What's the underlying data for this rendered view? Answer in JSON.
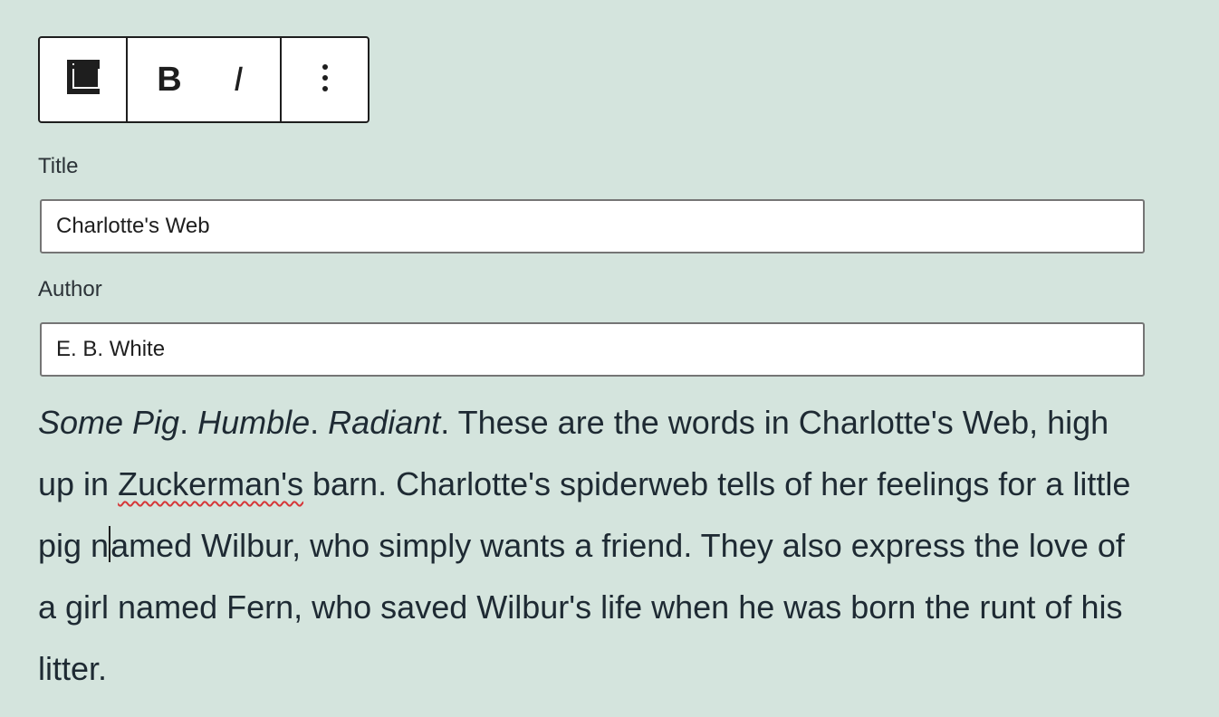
{
  "toolbar": {
    "block_icon": "book-icon",
    "bold_icon": "bold-icon",
    "bold_glyph": "B",
    "italic_icon": "italic-icon",
    "italic_glyph": "I",
    "more_icon": "more-vertical-icon"
  },
  "fields": {
    "title": {
      "label": "Title",
      "value": "Charlotte's Web"
    },
    "author": {
      "label": "Author",
      "value": "E. B. White"
    }
  },
  "description": {
    "italic_1": "Some Pig",
    "sep_1": ". ",
    "italic_2": "Humble",
    "sep_2": ". ",
    "italic_3": "Radiant",
    "text_1": ". These are the words in Charlotte's Web, high up in ",
    "misspelled": "Zuckerman's",
    "text_2": " barn. Charlotte's spiderweb tells of her feelings for a little pig n",
    "text_3": "amed Wilbur, who simply wants a friend. They also express the love of a girl named Fern, who saved Wilbur's life when he was born the runt of his litter."
  },
  "colors": {
    "background": "#d4e4dd",
    "text": "#1e2a33",
    "border": "#1e1e1e",
    "spellcheck_underline": "#d63638"
  }
}
